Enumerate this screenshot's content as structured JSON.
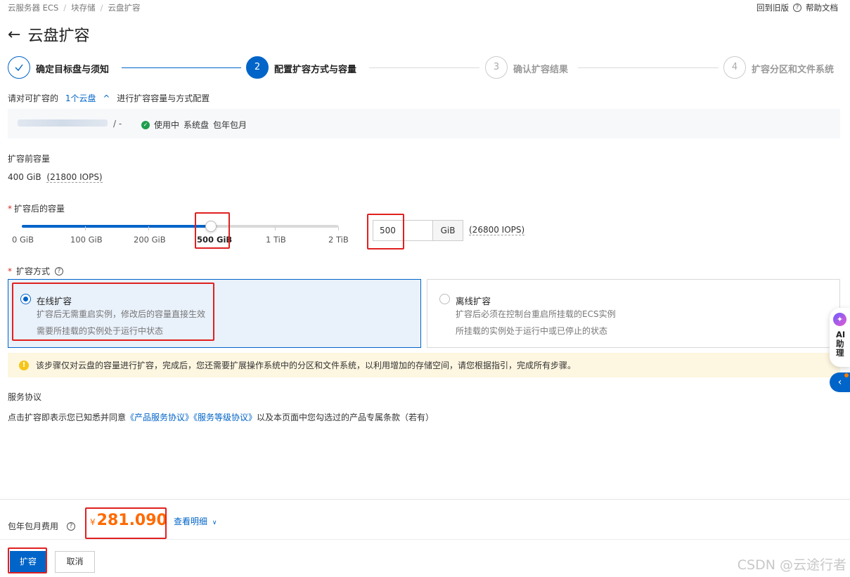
{
  "breadcrumb": [
    "云服务器 ECS",
    "块存储",
    "云盘扩容"
  ],
  "topbar": {
    "back_old": "回到旧版",
    "help": "帮助文档"
  },
  "page": {
    "title": "云盘扩容"
  },
  "steps": [
    {
      "num": "1",
      "label": "确定目标盘与须知",
      "state": "done"
    },
    {
      "num": "2",
      "label": "配置扩容方式与容量",
      "state": "active"
    },
    {
      "num": "3",
      "label": "确认扩容结果",
      "state": "pending"
    },
    {
      "num": "4",
      "label": "扩容分区和文件系统",
      "state": "pending"
    }
  ],
  "intro": {
    "prefix": "请对可扩容的",
    "link": "1个云盘",
    "suffix": "进行扩容容量与方式配置"
  },
  "disk": {
    "separator": "/ -",
    "status": "使用中",
    "type": "系统盘",
    "billing": "包年包月"
  },
  "before": {
    "label": "扩容前容量",
    "value": "400 GiB",
    "iops": "(21800 IOPS)"
  },
  "after": {
    "label": "扩容后的容量",
    "required_mark": "*",
    "slider_ticks": [
      "0 GiB",
      "100 GiB",
      "200 GiB",
      "500 GiB",
      "1 TiB",
      "2 TiB"
    ],
    "slider_fraction": 0.596,
    "input_value": "500",
    "unit": "GiB",
    "iops": "(26800 IOPS)"
  },
  "method": {
    "label": "扩容方式",
    "online": {
      "title": "在线扩容",
      "desc1": "扩容后无需重启实例，修改后的容量直接生效",
      "desc2": "需要所挂载的实例处于运行中状态"
    },
    "offline": {
      "title": "离线扩容",
      "desc1": "扩容后必须在控制台重启所挂载的ECS实例",
      "desc2": "所挂载的实例处于运行中或已停止的状态"
    }
  },
  "notice": "该步骤仅对云盘的容量进行扩容，完成后，您还需要扩展操作系统中的分区和文件系统，以利用增加的存储空间，请您根据指引，完成所有步骤。",
  "agreement": {
    "title": "服务协议",
    "prefix": "点击扩容即表示您已知悉并同意",
    "link1": "《产品服务协议》",
    "link2": "《服务等级协议》",
    "suffix": "以及本页面中您勾选过的产品专属条款（若有）"
  },
  "side": {
    "ai_label": "AI助理"
  },
  "footer": {
    "fee_label": "包年包月费用",
    "currency": "¥",
    "price": "281.090",
    "detail_link": "查看明细",
    "confirm": "扩容",
    "cancel": "取消"
  },
  "watermark": "CSDN @云途行者",
  "colors": {
    "primary": "#0064c8",
    "price": "#ff6a00",
    "highlight": "#e02020",
    "success": "#1e9e4d"
  }
}
